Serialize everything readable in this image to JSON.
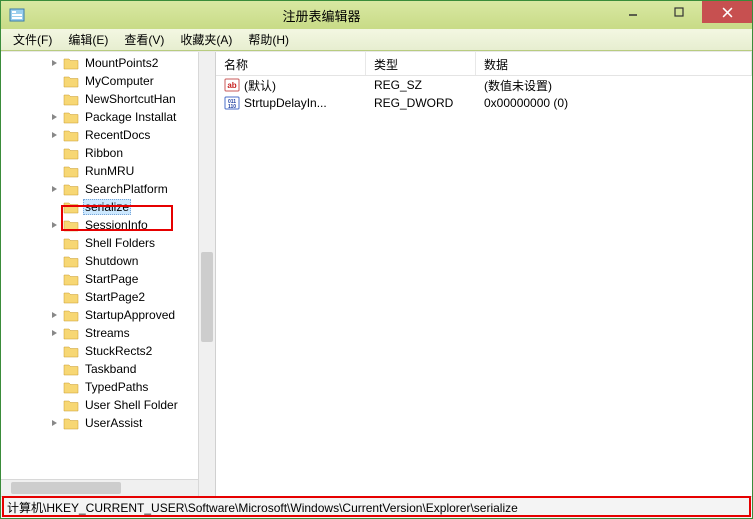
{
  "window": {
    "title": "注册表编辑器"
  },
  "menu": {
    "file": "文件(F)",
    "edit": "编辑(E)",
    "view": "查看(V)",
    "favorites": "收藏夹(A)",
    "help": "帮助(H)"
  },
  "tree": {
    "items": [
      {
        "label": "MountPoints2",
        "expandable": true
      },
      {
        "label": "MyComputer",
        "expandable": false
      },
      {
        "label": "NewShortcutHan",
        "expandable": false
      },
      {
        "label": "Package Installat",
        "expandable": true
      },
      {
        "label": "RecentDocs",
        "expandable": true
      },
      {
        "label": "Ribbon",
        "expandable": false
      },
      {
        "label": "RunMRU",
        "expandable": false
      },
      {
        "label": "SearchPlatform",
        "expandable": true
      },
      {
        "label": "serialize",
        "expandable": false,
        "selected": true
      },
      {
        "label": "SessionInfo",
        "expandable": true
      },
      {
        "label": "Shell Folders",
        "expandable": false
      },
      {
        "label": "Shutdown",
        "expandable": false
      },
      {
        "label": "StartPage",
        "expandable": false
      },
      {
        "label": "StartPage2",
        "expandable": false
      },
      {
        "label": "StartupApproved",
        "expandable": true
      },
      {
        "label": "Streams",
        "expandable": true
      },
      {
        "label": "StuckRects2",
        "expandable": false
      },
      {
        "label": "Taskband",
        "expandable": false
      },
      {
        "label": "TypedPaths",
        "expandable": false
      },
      {
        "label": "User Shell Folder",
        "expandable": false
      },
      {
        "label": "UserAssist",
        "expandable": true
      }
    ]
  },
  "list": {
    "headers": {
      "name": "名称",
      "type": "类型",
      "data": "数据"
    },
    "rows": [
      {
        "icon": "string",
        "name": "(默认)",
        "type": "REG_SZ",
        "data": "(数值未设置)"
      },
      {
        "icon": "binary",
        "name": "StrtupDelayIn...",
        "type": "REG_DWORD",
        "data": "0x00000000 (0)"
      }
    ]
  },
  "status": {
    "path": "计算机\\HKEY_CURRENT_USER\\Software\\Microsoft\\Windows\\CurrentVersion\\Explorer\\serialize"
  }
}
